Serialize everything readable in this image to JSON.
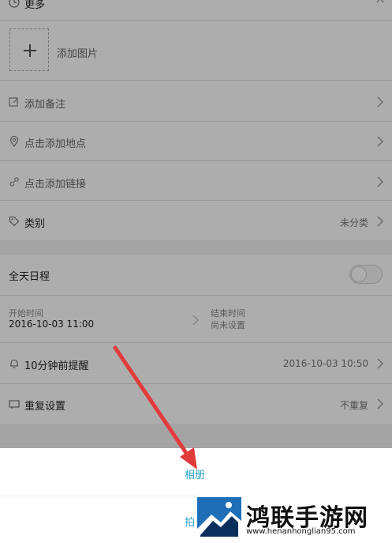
{
  "form": {
    "more_label": "更多",
    "add_photo_label": "添加图片",
    "add_note_label": "添加备注",
    "add_location_label": "点击添加地点",
    "add_link_label": "点击添加链接",
    "category_label": "类别",
    "category_value": "未分类",
    "all_day_label": "全天日程",
    "all_day_enabled": false,
    "start_label": "开始时间",
    "start_value": "2016-10-03 11:00",
    "end_label": "结束时间",
    "end_value": "尚未设置",
    "reminder_label": "10分钟前提醒",
    "reminder_value": "2016-10-03 10:50",
    "repeat_label": "重复设置",
    "repeat_value": "不重复"
  },
  "sheet": {
    "album_label": "相册",
    "camera_label": "拍"
  },
  "watermark": {
    "title": "鸿联手游网",
    "url": "www.henanhonglian95.com"
  },
  "colors": {
    "accent": "#2aa3c6",
    "arrow": "#e23b3b",
    "overlay": "rgba(0,0,0,0.32)"
  }
}
